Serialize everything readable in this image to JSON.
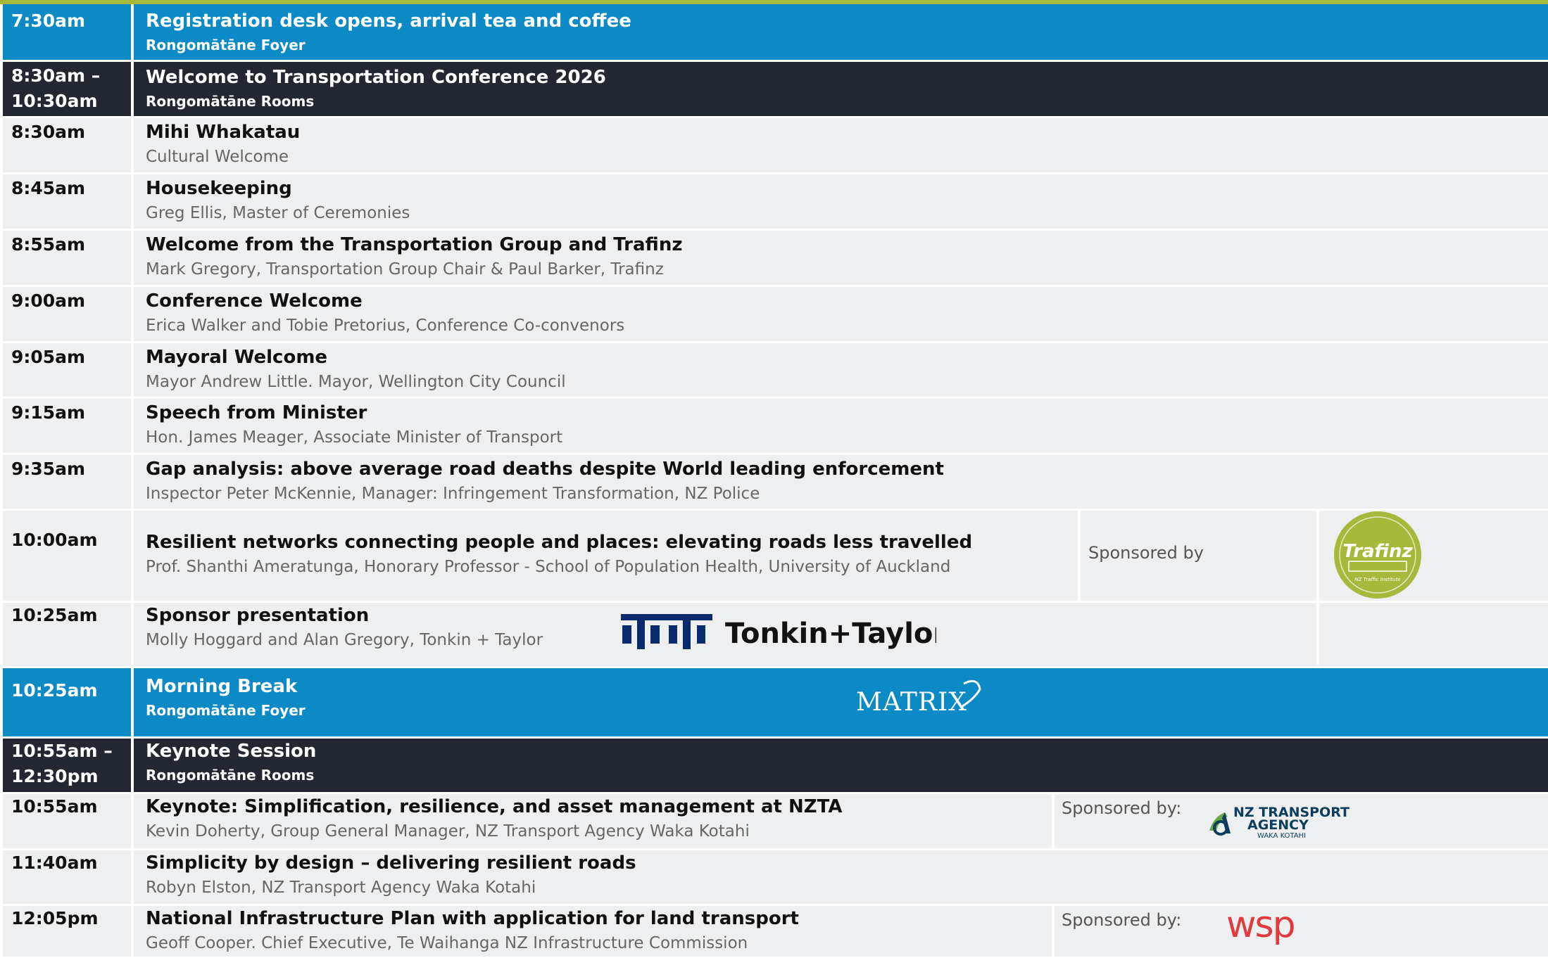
{
  "agenda": [
    {
      "time": "7:30am",
      "title": "Registration desk opens, arrival tea and coffee",
      "location": "Rongomātāne Foyer"
    },
    {
      "time_line1": "8:30am –",
      "time_line2": "10:30am",
      "title": "Welcome to Transportation Conference 2026",
      "location": "Rongomātāne Rooms"
    },
    {
      "time": "8:30am",
      "title": "Mihi Whakatau",
      "subtitle": "Cultural Welcome"
    },
    {
      "time": "8:45am",
      "title": "Housekeeping",
      "subtitle": "Greg Ellis, Master of Ceremonies"
    },
    {
      "time": "8:55am",
      "title": "Welcome from the Transportation Group and Trafinz",
      "subtitle": "Mark Gregory, Transportation Group Chair & Paul Barker, Trafinz"
    },
    {
      "time": "9:00am",
      "title": "Conference Welcome",
      "subtitle": "Erica Walker and Tobie Pretorius, Conference Co-convenors"
    },
    {
      "time": "9:05am",
      "title": "Mayoral Welcome",
      "subtitle": "Mayor Andrew Little. Mayor, Wellington City Council"
    },
    {
      "time": "9:15am",
      "title": "Speech from Minister",
      "subtitle": "Hon. James Meager, Associate Minister of Transport"
    },
    {
      "time": "9:35am",
      "title": "Gap analysis: above average road deaths despite World leading enforcement",
      "subtitle": "Inspector Peter McKennie, Manager: Infringement Transformation, NZ Police"
    },
    {
      "time": "10:00am",
      "title": "Resilient networks connecting people and places: elevating roads less travelled",
      "subtitle": "Prof. Shanthi Ameratunga, Honorary Professor - School of Population Health, University of Auckland",
      "sponsor_label": "Sponsored by",
      "sponsor_logo": "Trafinz",
      "sponsor_logo_text": "Trafinz",
      "sponsor_logo_subtext": "NZ Traffic Institute"
    },
    {
      "time": "10:25am",
      "title": "Sponsor presentation",
      "subtitle": "Molly Hoggard and Alan Gregory, Tonkin + Taylor",
      "sponsor_logo": "Tonkin+Taylor",
      "sponsor_logo_text": "Tonkin+Taylor"
    },
    {
      "time": "10:25am",
      "title": "Morning Break",
      "location": "Rongomātāne Foyer",
      "sponsor_logo": "Matrix",
      "sponsor_logo_text": "MATRIX"
    },
    {
      "time_line1": "10:55am –",
      "time_line2": "12:30pm",
      "title": "Keynote Session",
      "location": "Rongomātāne Rooms"
    },
    {
      "time": "10:55am",
      "title": "Keynote: Simplification, resilience, and asset management at NZTA",
      "subtitle": "Kevin Doherty, Group General Manager, NZ Transport Agency Waka Kotahi",
      "sponsor_label": "Sponsored by:",
      "sponsor_logo": "NZ Transport Agency",
      "sponsor_logo_line1": "NZ TRANSPORT",
      "sponsor_logo_line2": "AGENCY",
      "sponsor_logo_line3": "WAKA KOTAHI"
    },
    {
      "time": "11:40am",
      "title": "Simplicity by design – delivering resilient roads",
      "subtitle": "Robyn Elston, NZ Transport Agency Waka Kotahi"
    },
    {
      "time": "12:05pm",
      "title": "National Infrastructure Plan with application for land transport",
      "subtitle": "Geoff Cooper. Chief Executive, Te Waihanga NZ Infrastructure Commission",
      "sponsor_label": "Sponsored by:",
      "sponsor_logo": "WSP",
      "sponsor_logo_text": "wsp"
    }
  ],
  "colors": {
    "blue": "#0b8ac6",
    "dark": "#232731",
    "gray": "#eeeff0",
    "accent": "#a9b73a",
    "trafinz": "#a8b83a",
    "wsp": "#e03a3e",
    "tonkin": "#0a2a6e"
  }
}
